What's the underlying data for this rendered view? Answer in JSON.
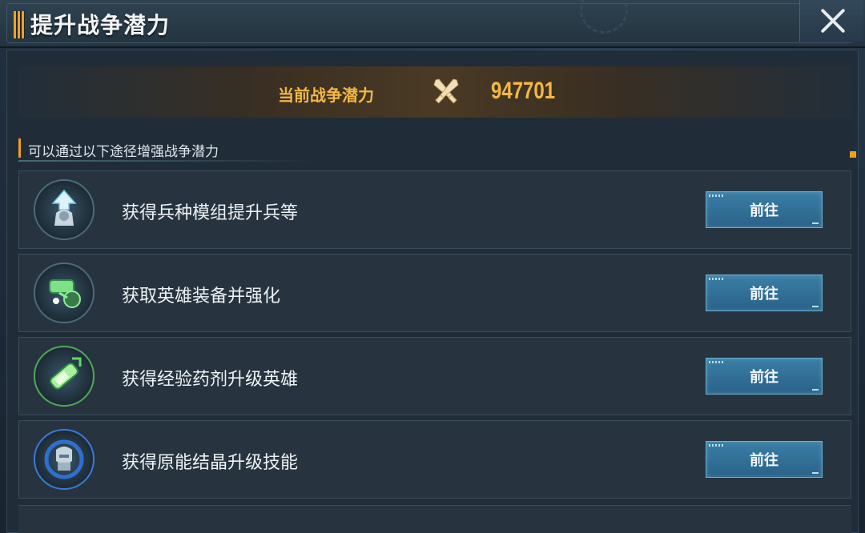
{
  "window": {
    "title": "提升战争潜力",
    "close_icon": "close-icon"
  },
  "power": {
    "label": "当前战争潜力",
    "icon": "crossed-swords-icon",
    "value": "947701"
  },
  "section": {
    "title": "可以通过以下途径增强战争潜力"
  },
  "tasks": [
    {
      "label": "获得兵种模组提升兵等",
      "icon": "rank-up-soldier-icon",
      "button": "前往"
    },
    {
      "label": "获取英雄装备并强化",
      "icon": "hero-equipment-icon",
      "button": "前往"
    },
    {
      "label": "获得经验药剂升级英雄",
      "icon": "exp-potion-icon",
      "button": "前往"
    },
    {
      "label": "获得原能结晶升级技能",
      "icon": "skill-crystal-icon",
      "button": "前往"
    }
  ],
  "colors": {
    "accent": "#f0a020",
    "power_text": "#f3b844",
    "button": "#2f6e96"
  }
}
